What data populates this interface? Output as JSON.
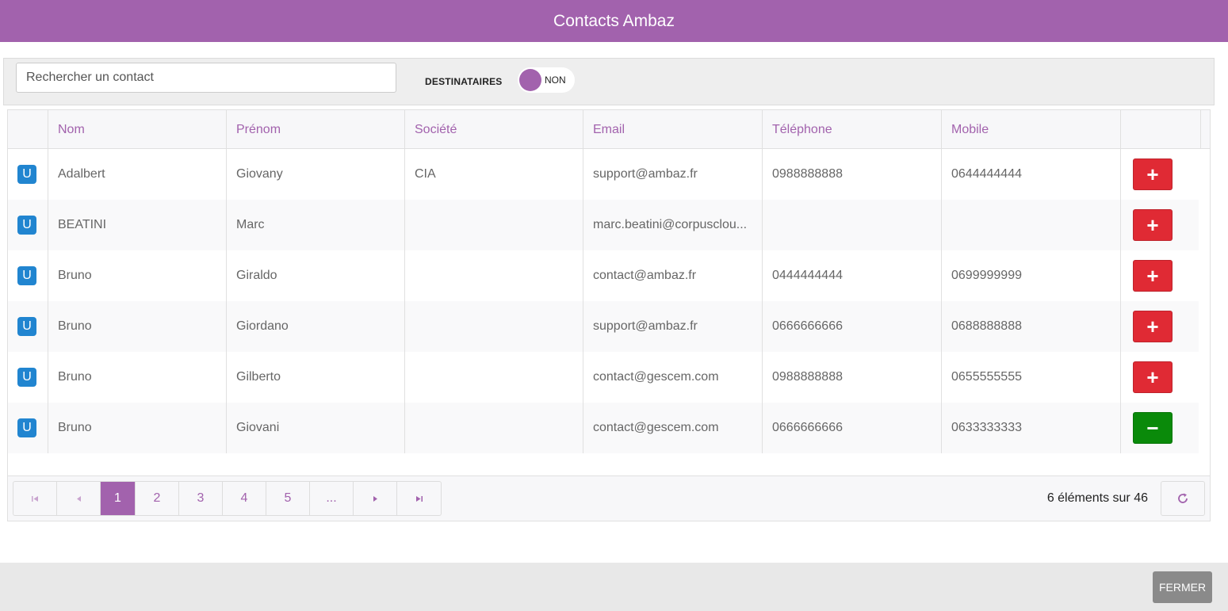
{
  "window": {
    "title": "Contacts Ambaz"
  },
  "toolbar": {
    "search_placeholder": "Rechercher un contact",
    "recipients_label": "DESTINATAIRES",
    "toggle_label": "NON"
  },
  "colors": {
    "accent": "#a262ad",
    "badge": "#2185d0",
    "add": "#e02a34",
    "remove": "#0a8a0a"
  },
  "table": {
    "columns": [
      "",
      "Nom",
      "Prénom",
      "Société",
      "Email",
      "Téléphone",
      "Mobile",
      ""
    ],
    "rows": [
      {
        "badge": "U",
        "nom": "Adalbert",
        "prenom": "Giovany",
        "societe": "CIA",
        "email": "support@ambaz.fr",
        "telephone": "0988888888",
        "mobile": "0644444444",
        "action": "+",
        "action_type": "add"
      },
      {
        "badge": "U",
        "nom": "BEATINI",
        "prenom": "Marc",
        "societe": "",
        "email": "marc.beatini@corpusclou...",
        "telephone": "",
        "mobile": "",
        "action": "+",
        "action_type": "add"
      },
      {
        "badge": "U",
        "nom": "Bruno",
        "prenom": "Giraldo",
        "societe": "",
        "email": "contact@ambaz.fr",
        "telephone": "0444444444",
        "mobile": "0699999999",
        "action": "+",
        "action_type": "add"
      },
      {
        "badge": "U",
        "nom": "Bruno",
        "prenom": "Giordano",
        "societe": "",
        "email": "support@ambaz.fr",
        "telephone": "0666666666",
        "mobile": "0688888888",
        "action": "+",
        "action_type": "add"
      },
      {
        "badge": "U",
        "nom": "Bruno",
        "prenom": "Gilberto",
        "societe": "",
        "email": "contact@gescem.com",
        "telephone": "0988888888",
        "mobile": "0655555555",
        "action": "+",
        "action_type": "add"
      },
      {
        "badge": "U",
        "nom": "Bruno",
        "prenom": "Giovani",
        "societe": "",
        "email": "contact@gescem.com",
        "telephone": "0666666666",
        "mobile": "0633333333",
        "action": "−",
        "action_type": "remove"
      }
    ]
  },
  "pagination": {
    "first_icon": "first-page-icon",
    "prev_icon": "prev-page-icon",
    "pages": [
      "1",
      "2",
      "3",
      "4",
      "5",
      "..."
    ],
    "current_page": "1",
    "next_icon": "next-page-icon",
    "last_icon": "last-page-icon",
    "count_text": "6 éléments sur 46",
    "refresh_icon": "refresh-icon"
  },
  "footer": {
    "close_label": "FERMER"
  }
}
